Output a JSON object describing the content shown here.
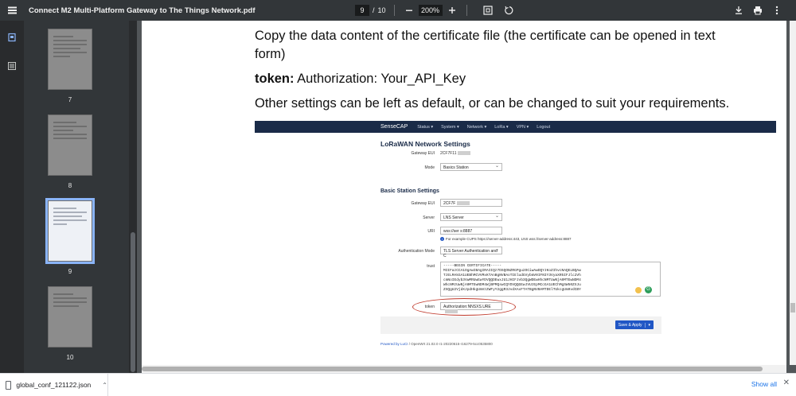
{
  "toolbar": {
    "title": "Connect M2 Multi-Platform Gateway to The Things Network.pdf",
    "current_page": "9",
    "page_separator": "/",
    "total_pages": "10",
    "zoom": "200%",
    "icons": [
      "menu-icon",
      "zoom-out-icon",
      "zoom-in-icon",
      "fit-page-icon",
      "rotate-icon",
      "download-icon",
      "print-icon",
      "more-vert-icon"
    ]
  },
  "sidebar": {
    "icons": [
      "thumbnails-icon",
      "outline-icon"
    ],
    "thumbnails": [
      {
        "label": "7",
        "selected": false
      },
      {
        "label": "8",
        "selected": false
      },
      {
        "label": "9",
        "selected": true
      },
      {
        "label": "10",
        "selected": false
      }
    ]
  },
  "page": {
    "line1": "Copy the data content of the certificate file (the certificate can be opened in text",
    "line2": "form)",
    "token_label": "token:",
    "token_text": " Authorization: Your_API_Key",
    "line4": "Other settings can be left as default, or can be changed to suit your requirements."
  },
  "screenshot": {
    "nav": {
      "brand": "SenseCAP",
      "items": [
        "Status ▾",
        "System ▾",
        "Network ▾",
        "LoRa ▾",
        "VPN ▾",
        "Logout"
      ]
    },
    "title": "LoRaWAN Network Settings",
    "gateway_eui_label": "Gateway EUI",
    "gateway_eui_value": "2CF7F11",
    "mode_label": "Mode",
    "mode_value": "Basics Station",
    "section_title": "Basic Station Settings",
    "bs_eui_label": "Gateway EUI",
    "bs_eui_value": "2CF7F",
    "server_label": "Server",
    "server_value": "LNS Server",
    "uri_label": "URI",
    "uri_value": "wss://ser            s:8887",
    "uri_hint": "For example CUPS https://server-address:443, LNS wss://server-address:8887",
    "auth_label": "Authentication Mode",
    "auth_value": "TLS Server Authentication and C",
    "trust_label": "trust",
    "trust_lines": [
      "-----BEGIN CERTIFICATE-----",
      "MIIFazCCA1OgAwIBAgIRAIIQz7DSQONZRGPgu2OCiwAwDQYJKoZIhvcNAQELBQAw",
      "TzELMAkGA1UEBhMCVVMxKTAnBgNVBAoTIEludGVybmV0IFNIY3VyaXR5IFJlc2Vh",
      "cmNoIEdyb3VwMRUwEwYDVQQDEwxJU1JHIFJvb3QgWDEwHhcNMTUwNjA0MTEwNDM4",
      "WhcNMzUwNjA0MTEwNDM4WjBPMQswCQYDVQQGEwJVUzEpMCcGA1UEChMgSW50ZXJu",
      "ZXQgU2VjdXJpdHkgUmVzZWFyY2ggR3JvdXAxFTATBgNVBAMTDElTUkcgUm9vdCBY"
    ],
    "token_label": "token",
    "token_value": "Authorization:NNSXS.URE",
    "save_label": "Save & Apply",
    "save_caret": "▾",
    "powered_link": "Powered by LuCI",
    "powered_rest": " / OpenWrt 21.02.0 r1-20220615-r16279-5cc0535800"
  },
  "downloads": {
    "filename": "global_conf_121122.json",
    "show_all": "Show all",
    "close": "✕"
  }
}
